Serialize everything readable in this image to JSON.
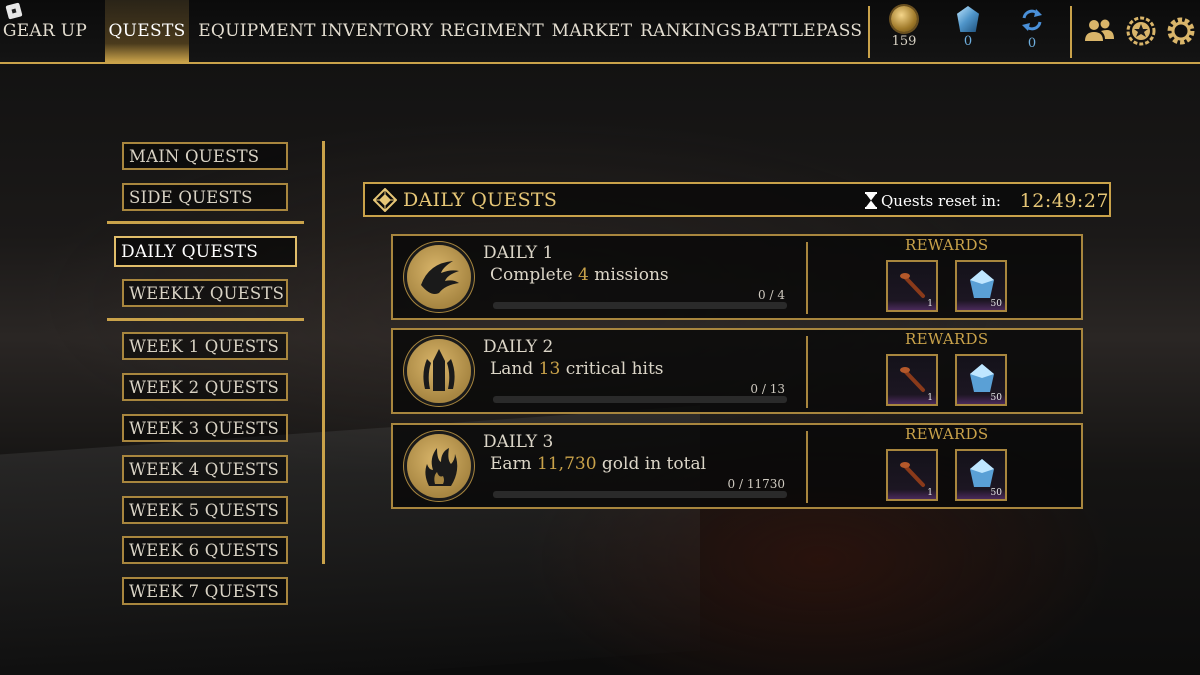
{
  "nav": {
    "tabs": [
      {
        "label": "GEAR UP"
      },
      {
        "label": "QUESTS",
        "active": true
      },
      {
        "label": "EQUIPMENT"
      },
      {
        "label": "INVENTORY"
      },
      {
        "label": "REGIMENT"
      },
      {
        "label": "MARKET"
      },
      {
        "label": "RANKINGS"
      },
      {
        "label": "BATTLEPASS"
      }
    ],
    "currencies": [
      {
        "icon": "gold-coin-icon",
        "value": "159"
      },
      {
        "icon": "crystal-gem-icon",
        "value": "0"
      },
      {
        "icon": "refresh-token-icon",
        "value": "0"
      }
    ],
    "utility_icons": [
      "friends-icon",
      "rank-badge-icon",
      "settings-gear-icon"
    ]
  },
  "sidebar": {
    "items": [
      {
        "label": "MAIN QUESTS"
      },
      {
        "label": "SIDE QUESTS"
      },
      {
        "label": "DAILY QUESTS",
        "active": true
      },
      {
        "label": "WEEKLY QUESTS"
      },
      {
        "label": "WEEK 1 QUESTS"
      },
      {
        "label": "WEEK 2 QUESTS"
      },
      {
        "label": "WEEK 3 QUESTS"
      },
      {
        "label": "WEEK 4 QUESTS"
      },
      {
        "label": "WEEK 5 QUESTS"
      },
      {
        "label": "WEEK 6 QUESTS"
      },
      {
        "label": "WEEK 7 QUESTS"
      }
    ]
  },
  "header": {
    "title": "DAILY QUESTS",
    "reset_label": "Quests reset in:",
    "reset_time": "12:49:27"
  },
  "quests": [
    {
      "title": "DAILY 1",
      "desc_pre": "Complete ",
      "desc_hl": "4",
      "desc_post": " missions",
      "progress_text": "0 / 4",
      "progress": 0,
      "emblem": "claw-emblem-icon",
      "rewards_label": "REWARDS",
      "rewards": [
        {
          "icon": "torch-item-icon",
          "count": "1"
        },
        {
          "icon": "crystal-gem-icon",
          "count": "50"
        }
      ]
    },
    {
      "title": "DAILY 2",
      "desc_pre": "Land ",
      "desc_hl": "13",
      "desc_post": " critical hits",
      "progress_text": "0 / 13",
      "progress": 0,
      "emblem": "spire-emblem-icon",
      "rewards_label": "REWARDS",
      "rewards": [
        {
          "icon": "torch-item-icon",
          "count": "1"
        },
        {
          "icon": "crystal-gem-icon",
          "count": "50"
        }
      ]
    },
    {
      "title": "DAILY 3",
      "desc_pre": "Earn ",
      "desc_hl": "11,730",
      "desc_post": " gold in total",
      "progress_text": "0 / 11730",
      "progress": 0,
      "emblem": "flame-hand-emblem-icon",
      "rewards_label": "REWARDS",
      "rewards": [
        {
          "icon": "torch-item-icon",
          "count": "1"
        },
        {
          "icon": "crystal-gem-icon",
          "count": "50"
        }
      ]
    }
  ],
  "colors": {
    "accent_gold": "#c9a24a",
    "highlight_gold": "#e6c676",
    "text": "#d8d2c4"
  }
}
